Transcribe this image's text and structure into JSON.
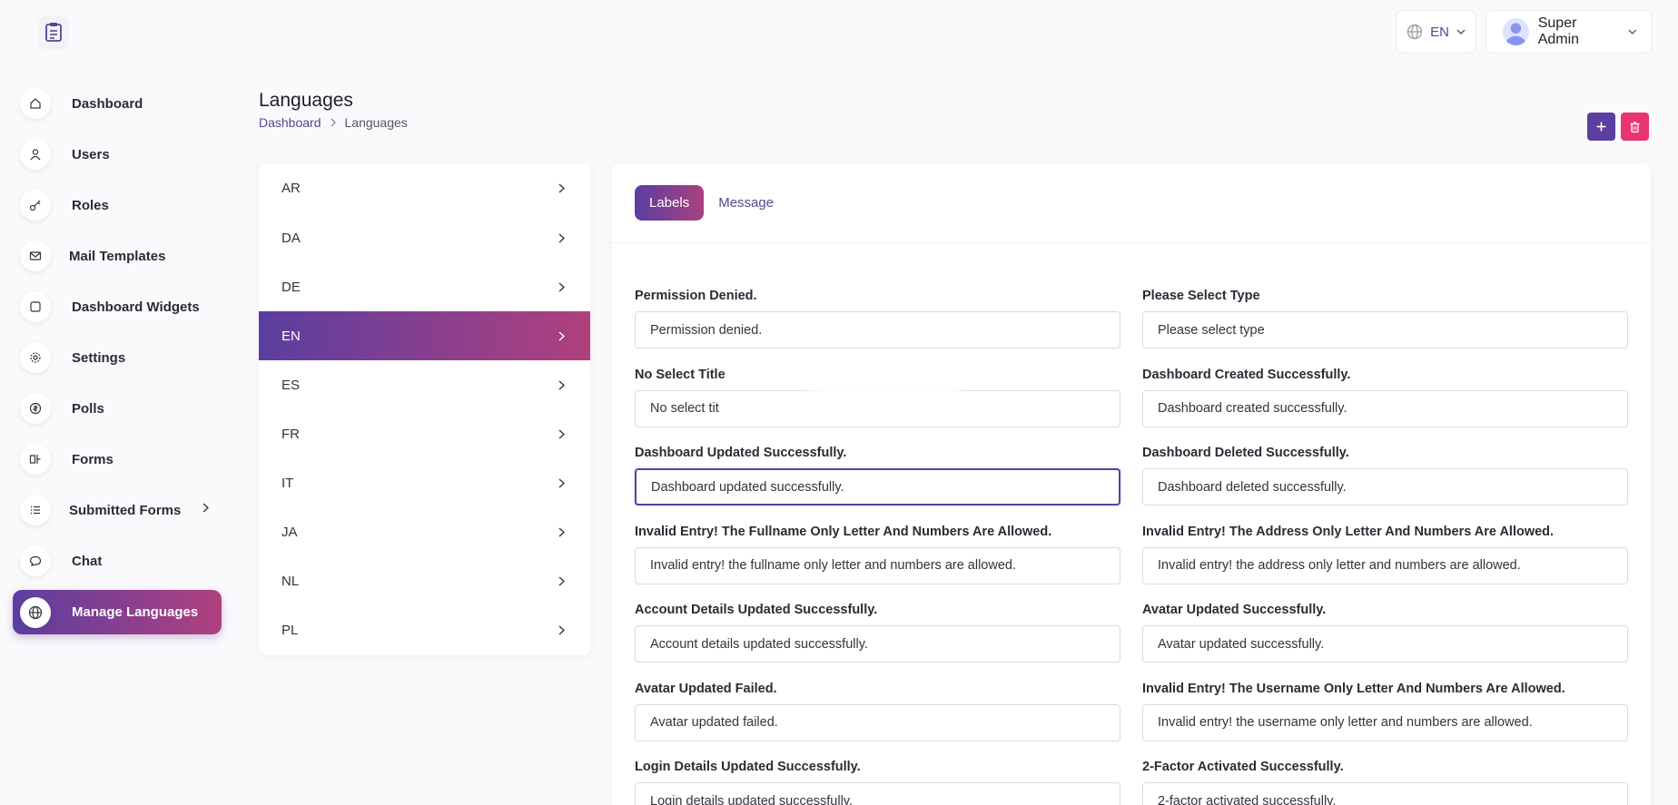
{
  "topbar": {
    "lang_code": "EN",
    "user_name": "Super Admin"
  },
  "sidebar": {
    "items": [
      {
        "label": "Dashboard",
        "icon": "home-icon"
      },
      {
        "label": "Users",
        "icon": "user-icon"
      },
      {
        "label": "Roles",
        "icon": "key-icon"
      },
      {
        "label": "Mail Templates",
        "icon": "mail-icon"
      },
      {
        "label": "Dashboard Widgets",
        "icon": "square-icon"
      },
      {
        "label": "Settings",
        "icon": "gear-icon"
      },
      {
        "label": "Polls",
        "icon": "poll-icon"
      },
      {
        "label": "Forms",
        "icon": "forms-icon"
      },
      {
        "label": "Submitted Forms",
        "icon": "list-icon"
      },
      {
        "label": "Chat",
        "icon": "chat-icon"
      },
      {
        "label": "Manage Languages",
        "icon": "globe-icon"
      }
    ]
  },
  "header": {
    "title": "Languages",
    "breadcrumb_home": "Dashboard",
    "breadcrumb_current": "Languages"
  },
  "languages": [
    "AR",
    "DA",
    "DE",
    "EN",
    "ES",
    "FR",
    "IT",
    "JA",
    "NL",
    "PL"
  ],
  "active_language": "EN",
  "tabs": {
    "labels": "Labels",
    "message": "Message"
  },
  "fields": [
    {
      "label": "Permission Denied.",
      "value": "Permission denied."
    },
    {
      "label": "Please Select Type",
      "value": "Please select type"
    },
    {
      "label": "No Select Title",
      "value": "No select tit"
    },
    {
      "label": "Dashboard Created Successfully.",
      "value": "Dashboard created successfully."
    },
    {
      "label": "Dashboard Updated Successfully.",
      "value": "Dashboard updated successfully."
    },
    {
      "label": "Dashboard Deleted Successfully.",
      "value": "Dashboard deleted successfully."
    },
    {
      "label": "Invalid Entry! The Fullname Only Letter And Numbers Are Allowed.",
      "value": "Invalid entry! the fullname only letter and numbers are allowed."
    },
    {
      "label": "Invalid Entry! The Address Only Letter And Numbers Are Allowed.",
      "value": "Invalid entry! the address only letter and numbers are allowed."
    },
    {
      "label": "Account Details Updated Successfully.",
      "value": "Account details updated successfully."
    },
    {
      "label": "Avatar Updated Successfully.",
      "value": "Avatar updated successfully."
    },
    {
      "label": "Avatar Updated Failed.",
      "value": "Avatar updated failed."
    },
    {
      "label": "Invalid Entry! The Username Only Letter And Numbers Are Allowed.",
      "value": "Invalid entry! the username only letter and numbers are allowed."
    },
    {
      "label": "Login Details Updated Successfully.",
      "value": "Login details updated successfully."
    },
    {
      "label": "2-Factor Activated Successfully.",
      "value": "2-factor activated successfully."
    }
  ],
  "colors": {
    "accent": "#5b3ea0",
    "accent_end": "#b0407e",
    "danger": "#e9356f"
  }
}
